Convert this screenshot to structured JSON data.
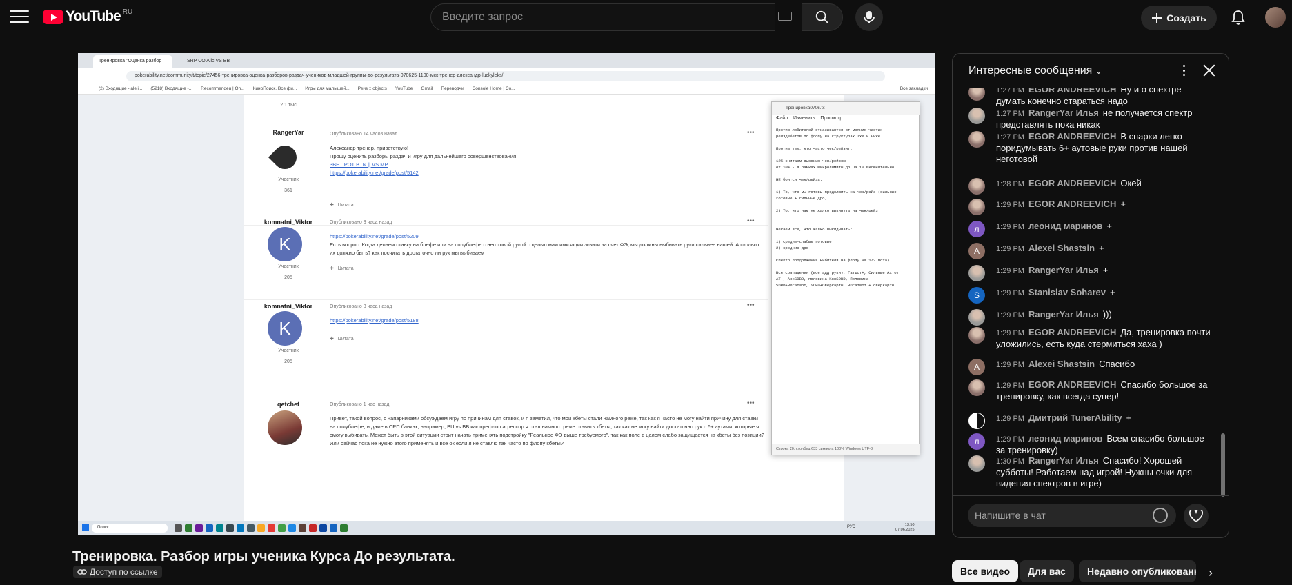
{
  "header": {
    "logo_text": "YouTube",
    "country": "RU",
    "search_placeholder": "Введите запрос",
    "create_label": "Создать"
  },
  "video": {
    "browser": {
      "tab1": "Тренировка \"Оценка разбор",
      "tab2": "SRP CO Allc VS BB",
      "url": "pokerability.net/community/t/topic/27456-тренировка-оценка-разборов-раздач-учеников-младшей-группы-до-результата-070625-1100-мск-тренер-александр-luckyleks/",
      "bookmarks": [
        "(2) Входящие - aleli...",
        "(5218) Входящие -...",
        "Recommendeu | On...",
        "КиноПоиск. Все фи...",
        "Игры для малышей...",
        "Реиз :: objects",
        "YouTube",
        "Gmail",
        "Переводчи",
        "Console Home | Co..."
      ],
      "bookmarks_right": "Все закладки"
    },
    "posts": [
      {
        "user": "RangerYar",
        "date": "Опубликовано 14 часов назад",
        "role": "Участник",
        "count": "361",
        "lines": [
          "Александр тренер, приветствую!",
          "Прошу оценить разборы раздач и игру для дальнейшего совершенствования"
        ],
        "links": [
          "3BET POT BTN || VS MP",
          "https://pokerability.net/grade/post/5142"
        ],
        "quote": "Цитата"
      },
      {
        "user": "komnatni_Viktor",
        "date": "Опубликовано 3 часа назад",
        "role": "Участник",
        "count": "205",
        "links": [
          "https://pokerability.net/grade/post/5209"
        ],
        "lines": [
          "Есть вопрос. Когда делаем ставку на блефе или на полублефе с неготовой рукой с целью максимизации эквити за счет ФЭ, мы должны выбивать руки сильнее нашей. А сколько их должно быть? как посчитать достаточно ли рук мы выбиваем"
        ],
        "quote": "Цитата"
      },
      {
        "user": "komnatni_Viktor",
        "date": "Опубликовано 3 часа назад",
        "role": "Участник",
        "count": "205",
        "links": [
          "https://pokerability.net/grade/post/5188"
        ],
        "quote": "Цитата"
      },
      {
        "user": "qetchet",
        "date": "Опубликовано 1 час назад",
        "lines": [
          "Привет, такой вопрос, с напарниками обсуждаем игру по причинам для ставок, и я заметил, что мои кбеты стали намного реже, так как я часто не могу найти причину для ставки на полублефе, и даже в СРП банках, например, BU vs BB как префлоп агрессор я стал намного реже ставить кбеты, так как не могу найти достаточно рук с 6+ аутами, которые я смогу выбивать. Может быть в этой ситуации стоит начать применять подстройку \"Реальное ФЭ выше требуемого\", так как поле в целом слабо защищается на кбеты без позиции? Или сейчас пока не нужно этого применять и все ок если я не ставлю так часто по флопу кбеты?"
        ]
      }
    ],
    "first_count": "2.1 тыс",
    "notepad": {
      "title": "Тренировка0706.tx",
      "menu": [
        "Файл",
        "Изменить",
        "Просмотр"
      ],
      "text": "Против лобителей отказываются от мелких частых\nрейздебетов по флопу на структурах Txx и ниже.\n\nПротив тех, кто часто чек/рейзит:\n\n12% считаем высоким чек/рейзом\nот 10% - в рамках микролимиты до ua 10 включительно\n\nНЕ боятся чек/рейза:\n\n1) То, что мы готовы продолжить на чек/рейз (сильные\nготовые + сильные дро)\n\n2) То, что нам не жалко выкинуть на чек/рейз\n\n\nЧекаем всё, что жалко выкидывать:\n\n1) средне-слабые готовые\n2) средние дро\n\nСпектр продолжения Вибителя на флопу на 1/3 пота)\n\nВсе совпадения (все адд руки), Гатшот+, Сильные Ax от\nAT+, AxxSDBD, половина KxxSDBD, Половина\nSDBD+BDгатшот, SDBD+Оверкарты, BDгатшот + оверкарты",
      "status": "Строка 20, столбец 633 символа   100%   Windows   UTF-8"
    },
    "taskbar": {
      "search": "Поиск",
      "lang": "РУС",
      "time": "13:50",
      "date": "07.06.2025"
    }
  },
  "video_title": "Тренировка. Разбор игры ученика Курса До результата.",
  "access_label": "Доступ по ссылке",
  "chat": {
    "title": "Интересные сообщения",
    "input_placeholder": "Напишите в чат",
    "messages": [
      {
        "time": "1:27 PM",
        "author": "EGOR ANDREEVICH",
        "text": "Ну и о спектре думать конечно стараться надо",
        "avatar": "photo",
        "color": "#8a6f6a"
      },
      {
        "time": "1:27 PM",
        "author": "RangerYar Илья",
        "text": "не получается спектр представлять пока никак",
        "avatar": "photo",
        "color": "#9a9a98"
      },
      {
        "time": "1:27 PM",
        "author": "EGOR ANDREEVICH",
        "text": "В спарки легко поридумывать 6+ аутовые руки против нашей неготовой",
        "avatar": "photo",
        "color": "#8a6f6a"
      },
      {
        "time": "1:28 PM",
        "author": "EGOR ANDREEVICH",
        "text": "Окей",
        "avatar": "photo",
        "color": "#8a6f6a"
      },
      {
        "time": "1:29 PM",
        "author": "EGOR ANDREEVICH",
        "text": "+",
        "avatar": "photo",
        "color": "#8a6f6a"
      },
      {
        "time": "1:29 PM",
        "author": "леонид маринов",
        "text": "+",
        "avatar": "л",
        "color": "#7e57c2"
      },
      {
        "time": "1:29 PM",
        "author": "Alexei Shastsin",
        "text": "+",
        "avatar": "A",
        "color": "#8d6e63"
      },
      {
        "time": "1:29 PM",
        "author": "RangerYar Илья",
        "text": "+",
        "avatar": "photo",
        "color": "#9a9a98"
      },
      {
        "time": "1:29 PM",
        "author": "Stanislav Soharev",
        "text": "+",
        "avatar": "S",
        "color": "#1565c0"
      },
      {
        "time": "1:29 PM",
        "author": "RangerYar Илья",
        "text": ")))",
        "avatar": "photo",
        "color": "#9a9a98"
      },
      {
        "time": "1:29 PM",
        "author": "EGOR ANDREEVICH",
        "text": "Да, тренировка почти уложились, есть куда стермиться хаха )",
        "avatar": "photo",
        "color": "#8a6f6a"
      },
      {
        "time": "1:29 PM",
        "author": "Alexei Shastsin",
        "text": "Спасибо",
        "avatar": "A",
        "color": "#8d6e63"
      },
      {
        "time": "1:29 PM",
        "author": "EGOR ANDREEVICH",
        "text": "Спасибо большое за тренировку, как всегда супер!",
        "avatar": "photo",
        "color": "#8a6f6a"
      },
      {
        "time": "1:29 PM",
        "author": "Дмитрий TunerAbility",
        "text": "+",
        "avatar": "yin",
        "color": "#ffffff"
      },
      {
        "time": "1:29 PM",
        "author": "леонид маринов",
        "text": "Всем спасибо большое за тренировку)",
        "avatar": "л",
        "color": "#7e57c2"
      },
      {
        "time": "1:30 PM",
        "author": "RangerYar Илья",
        "text": "Спасибо! Хорошей субботы! Работаем над игрой! Нужны очки для видения спектров в игре)",
        "avatar": "photo",
        "color": "#9a9a98"
      }
    ]
  },
  "chips": [
    {
      "label": "Все видео",
      "active": true
    },
    {
      "label": "Для вас",
      "active": false
    },
    {
      "label": "Недавно опубликованн",
      "active": false
    }
  ]
}
